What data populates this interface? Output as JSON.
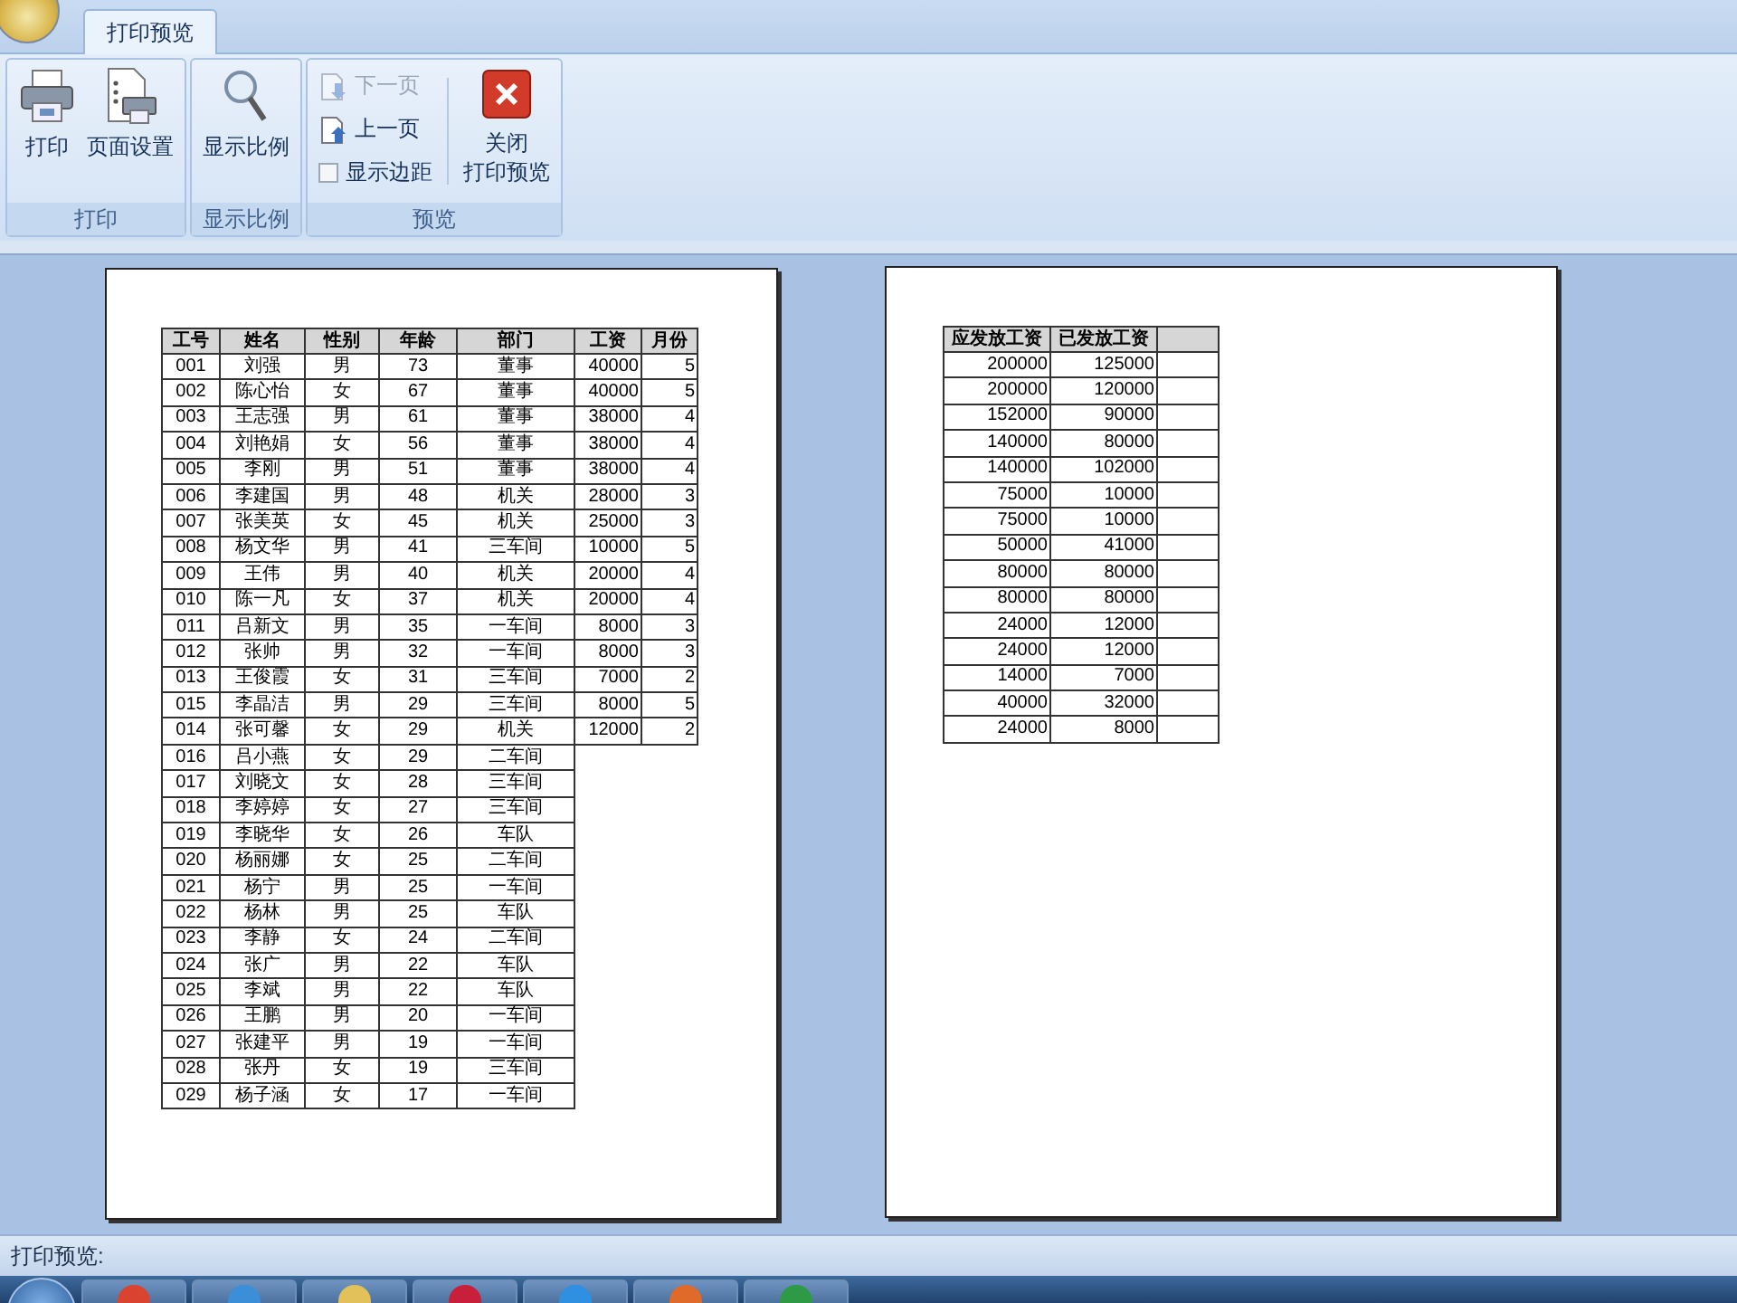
{
  "ribbon": {
    "tabs": [
      {
        "label": "打印预览",
        "selected": true
      }
    ],
    "groups": [
      {
        "label": "打印",
        "items": [
          {
            "kind": "large",
            "label": "打印",
            "disabled": false
          },
          {
            "kind": "large",
            "label": "页面设置",
            "disabled": false
          }
        ]
      },
      {
        "label": "显示比例",
        "items": [
          {
            "kind": "large",
            "label": "显示比例",
            "disabled": false
          }
        ]
      },
      {
        "label": "预览",
        "items": [
          {
            "kind": "small",
            "label": "下一页",
            "disabled": true
          },
          {
            "kind": "small",
            "label": "上一页",
            "disabled": false
          },
          {
            "kind": "checkbox",
            "label": "显示边距",
            "checked": false
          },
          {
            "kind": "separator"
          },
          {
            "kind": "large",
            "label_lines": [
              "关闭",
              "打印预览"
            ],
            "disabled": false
          }
        ]
      }
    ]
  },
  "pages": [
    {
      "columns": [
        "工号",
        "姓名",
        "性别",
        "年龄",
        "部门",
        "工资",
        "月份"
      ],
      "rows": [
        [
          "001",
          "刘强",
          "男",
          "73",
          "董事",
          "40000",
          "5"
        ],
        [
          "002",
          "陈心怡",
          "女",
          "67",
          "董事",
          "40000",
          "5"
        ],
        [
          "003",
          "王志强",
          "男",
          "61",
          "董事",
          "38000",
          "4"
        ],
        [
          "004",
          "刘艳娟",
          "女",
          "56",
          "董事",
          "38000",
          "4"
        ],
        [
          "005",
          "李刚",
          "男",
          "51",
          "董事",
          "38000",
          "4"
        ],
        [
          "006",
          "李建国",
          "男",
          "48",
          "机关",
          "28000",
          "3"
        ],
        [
          "007",
          "张美英",
          "女",
          "45",
          "机关",
          "25000",
          "3"
        ],
        [
          "008",
          "杨文华",
          "男",
          "41",
          "三车间",
          "10000",
          "5"
        ],
        [
          "009",
          "王伟",
          "男",
          "40",
          "机关",
          "20000",
          "4"
        ],
        [
          "010",
          "陈一凡",
          "女",
          "37",
          "机关",
          "20000",
          "4"
        ],
        [
          "011",
          "吕新文",
          "男",
          "35",
          "一车间",
          "8000",
          "3"
        ],
        [
          "012",
          "张帅",
          "男",
          "32",
          "一车间",
          "8000",
          "3"
        ],
        [
          "013",
          "王俊霞",
          "女",
          "31",
          "三车间",
          "7000",
          "2"
        ],
        [
          "015",
          "李晶洁",
          "男",
          "29",
          "三车间",
          "8000",
          "5"
        ],
        [
          "014",
          "张可馨",
          "女",
          "29",
          "机关",
          "12000",
          "2"
        ],
        [
          "016",
          "吕小燕",
          "女",
          "29",
          "二车间"
        ],
        [
          "017",
          "刘晓文",
          "女",
          "28",
          "三车间"
        ],
        [
          "018",
          "李婷婷",
          "女",
          "27",
          "三车间"
        ],
        [
          "019",
          "李晓华",
          "女",
          "26",
          "车队"
        ],
        [
          "020",
          "杨丽娜",
          "女",
          "25",
          "二车间"
        ],
        [
          "021",
          "杨宁",
          "男",
          "25",
          "一车间"
        ],
        [
          "022",
          "杨林",
          "男",
          "25",
          "车队"
        ],
        [
          "023",
          "李静",
          "女",
          "24",
          "二车间"
        ],
        [
          "024",
          "张广",
          "男",
          "22",
          "车队"
        ],
        [
          "025",
          "李斌",
          "男",
          "22",
          "车队"
        ],
        [
          "026",
          "王鹏",
          "男",
          "20",
          "一车间"
        ],
        [
          "027",
          "张建平",
          "男",
          "19",
          "一车间"
        ],
        [
          "028",
          "张丹",
          "女",
          "19",
          "三车间"
        ],
        [
          "029",
          "杨子涵",
          "女",
          "17",
          "一车间"
        ]
      ]
    },
    {
      "columns": [
        "应发放工资",
        "已发放工资",
        ""
      ],
      "rows": [
        [
          "200000",
          "125000",
          ""
        ],
        [
          "200000",
          "120000",
          ""
        ],
        [
          "152000",
          "90000",
          ""
        ],
        [
          "140000",
          "80000",
          ""
        ],
        [
          "140000",
          "102000",
          ""
        ],
        [
          "75000",
          "10000",
          ""
        ],
        [
          "75000",
          "10000",
          ""
        ],
        [
          "50000",
          "41000",
          ""
        ],
        [
          "80000",
          "80000",
          ""
        ],
        [
          "80000",
          "80000",
          ""
        ],
        [
          "24000",
          "12000",
          ""
        ],
        [
          "24000",
          "12000",
          ""
        ],
        [
          "14000",
          "7000",
          ""
        ],
        [
          "40000",
          "32000",
          ""
        ],
        [
          "24000",
          "8000",
          ""
        ]
      ]
    }
  ],
  "status_bar": "打印预览:"
}
